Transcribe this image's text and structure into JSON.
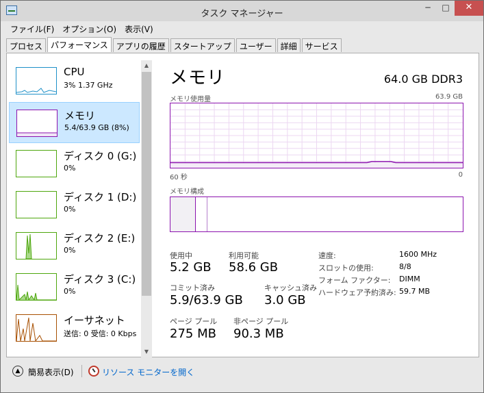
{
  "window": {
    "title": "タスク マネージャー",
    "minimize": "─",
    "maximize": "□",
    "close": "✕"
  },
  "menu": [
    "ファイル(F)",
    "オプション(O)",
    "表示(V)"
  ],
  "tabs": [
    "プロセス",
    "パフォーマンス",
    "アプリの履歴",
    "スタートアップ",
    "ユーザー",
    "詳細",
    "サービス"
  ],
  "active_tab": "パフォーマンス",
  "perf_list": [
    {
      "name": "CPU",
      "sub": "3% 1.37 GHz",
      "color": "#1e90c8",
      "icon": "cpu-graph"
    },
    {
      "name": "メモリ",
      "sub": "5.4/63.9 GB (8%)",
      "color": "#8b12ae",
      "icon": "memory-graph",
      "selected": true
    },
    {
      "name": "ディスク 0 (G:)",
      "sub": "0%",
      "color": "#4da60c",
      "icon": "disk-graph"
    },
    {
      "name": "ディスク 1 (D:)",
      "sub": "0%",
      "color": "#4da60c",
      "icon": "disk-graph"
    },
    {
      "name": "ディスク 2 (E:)",
      "sub": "0%",
      "color": "#4da60c",
      "icon": "disk-graph"
    },
    {
      "name": "ディスク 3 (C:)",
      "sub": "0%",
      "color": "#4da60c",
      "icon": "disk-graph"
    },
    {
      "name": "イーサネット",
      "sub": "送信: 0 受信: 0 Kbps",
      "color": "#a74f01",
      "icon": "ethernet-graph"
    }
  ],
  "detail": {
    "title": "メモリ",
    "spec": "64.0 GB DDR3",
    "usage_label": "メモリ使用量",
    "usage_max": "63.9 GB",
    "time_left": "60 秒",
    "time_right": "0",
    "composition_label": "メモリ構成",
    "usage_fraction": 0.08,
    "stats": {
      "in_use_label": "使用中",
      "in_use_value": "5.2 GB",
      "available_label": "利用可能",
      "available_value": "58.6 GB",
      "committed_label": "コミット済み",
      "committed_value": "5.9/63.9 GB",
      "cached_label": "キャッシュ済み",
      "cached_value": "3.0 GB",
      "paged_label": "ページ プール",
      "paged_value": "275 MB",
      "nonpaged_label": "非ページ プール",
      "nonpaged_value": "90.3 MB"
    },
    "properties": [
      {
        "label": "速度:",
        "value": "1600 MHz"
      },
      {
        "label": "スロットの使用:",
        "value": "8/8"
      },
      {
        "label": "フォーム ファクター:",
        "value": "DIMM"
      },
      {
        "label": "ハードウェア予約済み:",
        "value": "59.7 MB"
      }
    ]
  },
  "footer": {
    "fewer_details": "簡易表示(D)",
    "resource_monitor": "リソース モニターを開く"
  },
  "colors": {
    "memory": "#8b12ae",
    "cpu": "#1e90c8",
    "disk": "#4da60c",
    "ethernet": "#a74f01",
    "selected_bg": "#cce8ff"
  }
}
